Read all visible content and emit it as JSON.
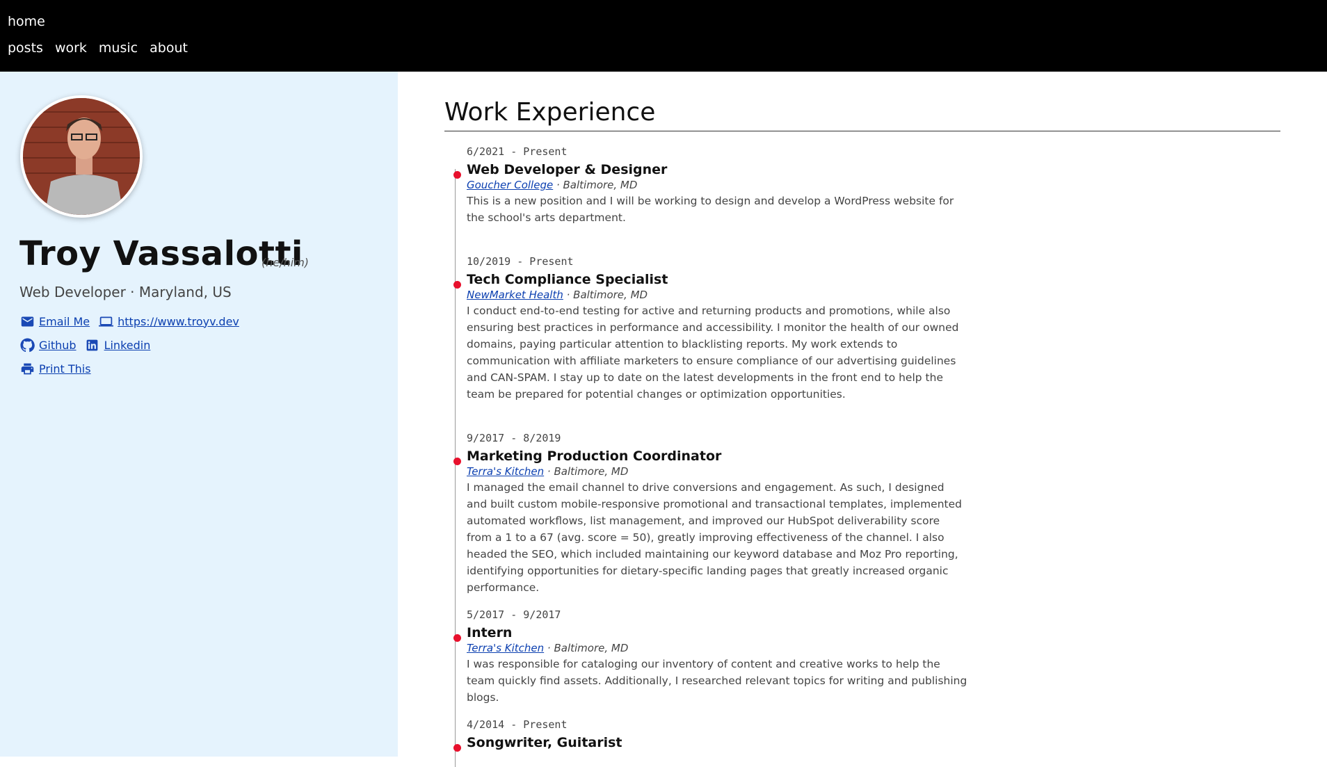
{
  "nav": {
    "home": "home",
    "links": [
      "posts",
      "work",
      "music",
      "about"
    ]
  },
  "profile": {
    "name": "Troy Vassalotti",
    "pronouns": "(he/him)",
    "tagline": "Web Developer · Maryland, US",
    "contacts": {
      "email": "Email Me",
      "website": "https://www.troyv.dev",
      "github": "Github",
      "linkedin": "Linkedin",
      "print": "Print This"
    }
  },
  "main": {
    "title": "Work Experience",
    "jobs": [
      {
        "dates": "6/2021 - Present",
        "title": "Web Developer & Designer",
        "company": "Goucher College",
        "location": " · Baltimore, MD",
        "desc": "This is a new position and I will be working to design and develop a WordPress website for the school's arts department."
      },
      {
        "dates": "10/2019 - Present",
        "title": "Tech Compliance Specialist",
        "company": "NewMarket Health",
        "location": " · Baltimore, MD",
        "desc": "I conduct end-to-end testing for active and returning products and promotions, while also ensuring best practices in performance and accessibility. I monitor the health of our owned domains, paying particular attention to blacklisting reports. My work extends to communication with affiliate marketers to ensure compliance of our advertising guidelines and CAN-SPAM. I stay up to date on the latest developments in the front end to help the team be prepared for potential changes or optimization opportunities."
      },
      {
        "dates": "9/2017 - 8/2019",
        "title": "Marketing Production Coordinator",
        "company": "Terra's Kitchen",
        "location": " · Baltimore, MD",
        "desc": "I managed the email channel to drive conversions and engagement. As such, I designed and built custom mobile-responsive promotional and transactional templates, implemented automated workflows, list management, and improved our HubSpot deliverability score from a 1 to a 67 (avg. score = 50), greatly improving effectiveness of the channel. I also headed the SEO, which included maintaining our keyword database and Moz Pro reporting, identifying opportunities for dietary-specific landing pages that greatly increased organic performance."
      },
      {
        "dates": "5/2017 - 9/2017",
        "title": "Intern",
        "company": "Terra's Kitchen",
        "location": " · Baltimore, MD",
        "desc": "I was responsible for cataloging our inventory of content and creative works to help the team quickly find assets. Additionally, I researched relevant topics for writing and publishing blogs."
      },
      {
        "dates": "4/2014 - Present",
        "title": "Songwriter, Guitarist",
        "company": "",
        "location": "",
        "desc": ""
      }
    ]
  }
}
